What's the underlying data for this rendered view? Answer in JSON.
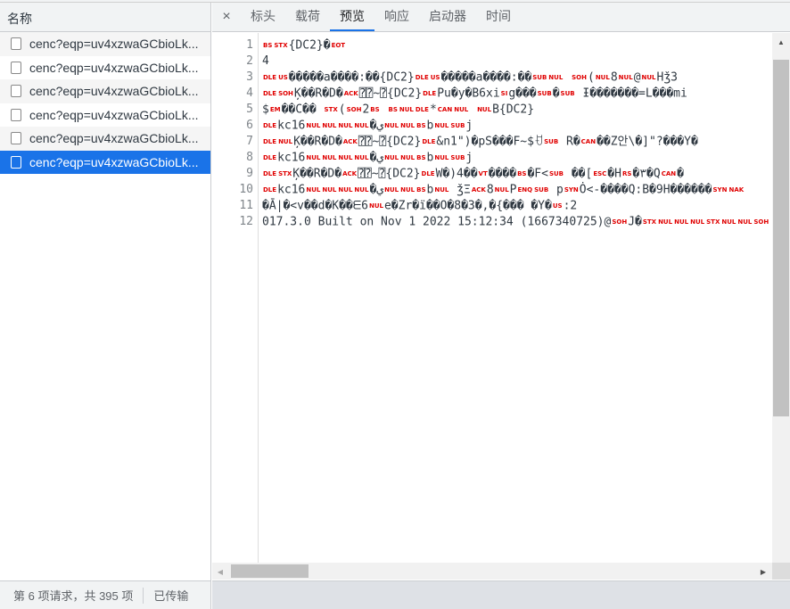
{
  "left_panel": {
    "header": "名称",
    "rows": [
      {
        "name": "cenc?eqp=uv4xzwaGCbioLk...",
        "selected": false
      },
      {
        "name": "cenc?eqp=uv4xzwaGCbioLk...",
        "selected": false
      },
      {
        "name": "cenc?eqp=uv4xzwaGCbioLk...",
        "selected": false
      },
      {
        "name": "cenc?eqp=uv4xzwaGCbioLk...",
        "selected": false
      },
      {
        "name": "cenc?eqp=uv4xzwaGCbioLk...",
        "selected": false
      },
      {
        "name": "cenc?eqp=uv4xzwaGCbioLk...",
        "selected": true
      }
    ]
  },
  "status": {
    "requests": "第 6 项请求，共 395 项",
    "transferred": "已传输"
  },
  "tabs": {
    "close": "×",
    "items": [
      "标头",
      "载荷",
      "预览",
      "响应",
      "启动器",
      "时间"
    ],
    "active": 2
  },
  "editor": {
    "line_numbers": [
      "1",
      "2",
      "3",
      "4",
      "5",
      "6",
      "7",
      "8",
      "9",
      "10",
      "11",
      "12"
    ],
    "lines": [
      "{BS}{STX}{DC2}�{EOT}",
      "4",
      "{DLE}{US}�����a����:��{DC2}{DLE}{US}�����a����:��{SUB}{NUL} {SOH}({NUL}8{NUL}@{NUL}Hǯ3",
      "{DLE}{SOH}Ķ��R�D�{ACK}⍰⍰~⍰{DC2}{DLE}Pu�y�B6xi{SI}g���{SUB}�{SUB} Ɨ�������=L���mi",
      "${EM}��C�� {STX}({SOH}2{BS} {BS}{NUL}{DLE}*{CAN}{NUL} {NUL}B{DC2}",
      "{DLE}kc16{NUL}{NUL}{NUL}{NUL}�ي{NUL}{NUL}{BS}b{NUL}{SUB}j",
      "{DLE}{NUL}Ķ��R�D�{ACK}⍰⍰~⍰{DC2}{DLE}&n1\")�pS���F~$ꀀ{SUB} R�{CAN}��Z안\\�]\"?���Y�",
      "{DLE}kc16{NUL}{NUL}{NUL}{NUL}�ي{NUL}{NUL}{BS}b{NUL}{SUB}j",
      "{DLE}{STX}Ķ��R�D�{ACK}⍰⍰~⍰{DC2}{DLE}W�)4��{VT}����{BS}�F<{SUB} ��[{ESC}�H{RS}�٣�Q{CAN}�",
      "{DLE}kc16{NUL}{NUL}{NUL}{NUL}�ي{NUL}{NUL}{BS}b{NUL} ǯΞ{ACK}8{NUL}P{ENQ}{SUB} p{SYN}Ȯ<-����Q:B�9H������{SYN}{NAK}",
      "�Ā|�<v��d�K��ᗴ6{NUL}e�Zr�ï��O�8�3�,�{��� �Y�{US}:2",
      "017.3.0 Built on Nov 1 2022 15:12:34 (1667340725)@{SOH}J�{STX}{NUL}{NUL}{NUL}{STX}{NUL}{NUL}{SOH}"
    ]
  },
  "colors": {
    "accent": "#1a73e8",
    "control_char": "#e00000"
  }
}
